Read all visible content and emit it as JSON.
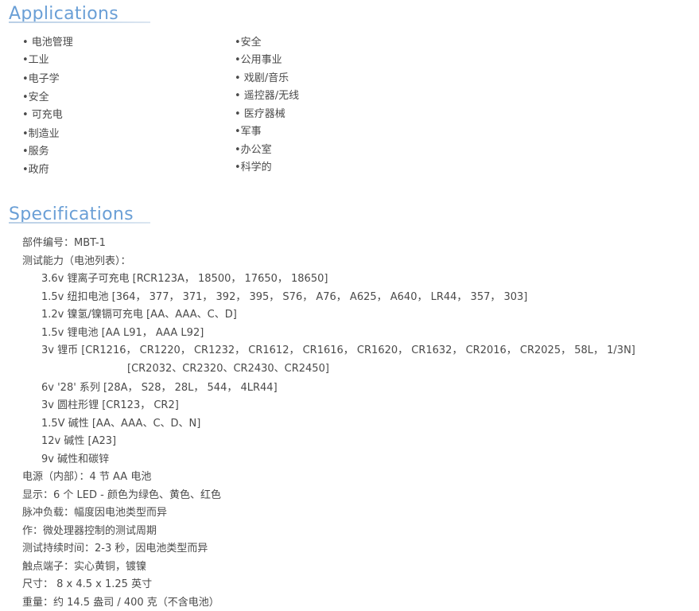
{
  "applications": {
    "heading": "Applications",
    "left": [
      "• 电池管理",
      "•工业",
      "•电子学",
      "•安全",
      "• 可充电",
      "•制造业",
      "•服务",
      "•政府"
    ],
    "right": [
      "•安全",
      "•公用事业",
      "• 戏剧/音乐",
      "• 遥控器/无线",
      "• 医疗器械",
      "•军事",
      "•办公室",
      "•科学的"
    ]
  },
  "specifications": {
    "heading": "Specifications",
    "lines": [
      "部件编号：MBT-1",
      "测试能力（电池列表）：",
      "3.6v 锂离子可充电 [RCR123A， 18500， 17650， 18650]",
      "1.5v 纽扣电池 [364， 377， 371， 392， 395， S76， A76， A625， A640， LR44， 357， 303]",
      "1.2v 镍氢/镍镉可充电 [AA、AAA、C、D]",
      "1.5v 锂电池 [AA L91， AAA L92]",
      "3v 锂币 [CR1216， CR1220， CR1232， CR1612， CR1616， CR1620， CR1632， CR2016， CR2025， 58L， 1/3N]",
      "[CR2032、CR2320、CR2430、CR2450]",
      "6v '28' 系列 [28A， S28， 28L， 544， 4LR44]",
      "3v 圆柱形锂 [CR123， CR2]",
      "1.5V 碱性 [AA、AAA、C、D、N]",
      "12v 碱性 [A23]",
      "9v 碱性和碳锌",
      "电源（内部）：4 节 AA 电池",
      "显示：6 个 LED - 颜色为绿色、黄色、红色",
      "脉冲负载：幅度因电池类型而异",
      "作：微处理器控制的测试周期",
      "测试持续时间：2-3 秒，因电池类型而异",
      "触点端子：实心黄铜，镀镍",
      "尺寸： 8 x 4.5 x 1.25 英寸",
      "重量：约 14.5 盎司 / 400 克（不含电池）"
    ]
  }
}
